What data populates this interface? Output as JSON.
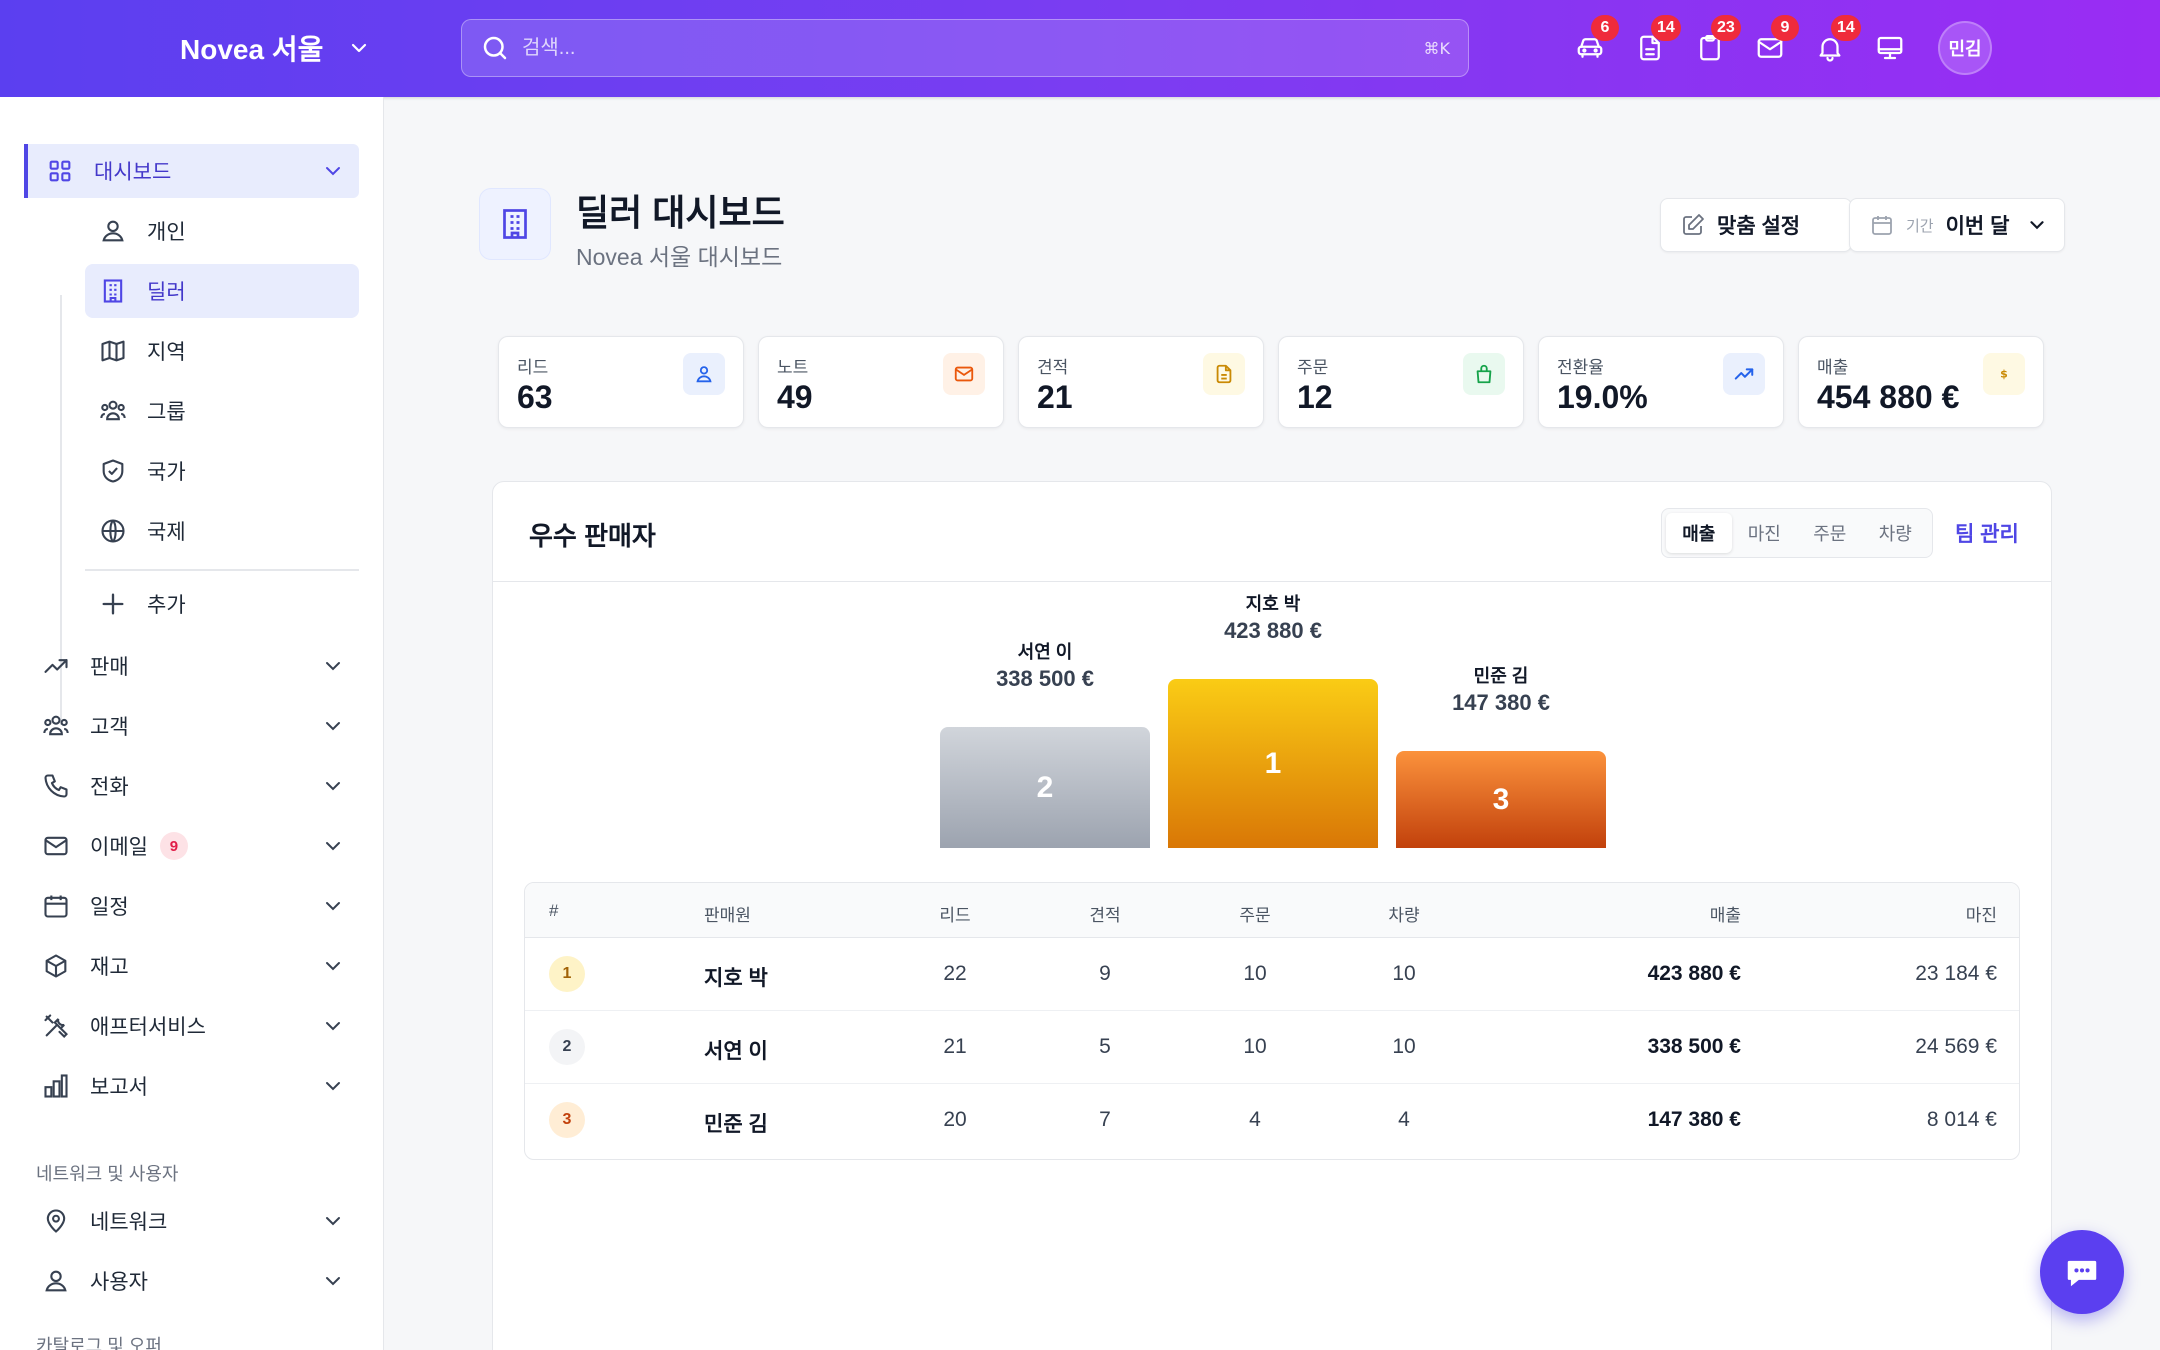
{
  "header": {
    "brand": "Novea 서울",
    "search_placeholder": "검색...",
    "search_shortcut": "⌘K",
    "icons": [
      {
        "name": "car-icon",
        "badge": "6"
      },
      {
        "name": "document-icon",
        "badge": "14"
      },
      {
        "name": "clipboard-icon",
        "badge": "23"
      },
      {
        "name": "mail-icon",
        "badge": "9"
      },
      {
        "name": "bell-icon",
        "badge": "14"
      },
      {
        "name": "monitor-icon",
        "badge": ""
      }
    ],
    "avatar": "민김"
  },
  "sidebar": {
    "dashboard": "대시보드",
    "sub": [
      "개인",
      "딜러",
      "지역",
      "그룹",
      "국가",
      "국제"
    ],
    "add": "추가",
    "items": [
      "판매",
      "고객",
      "전화",
      "이메일",
      "일정",
      "재고",
      "애프터서비스",
      "보고서"
    ],
    "email_badge": "9",
    "section_network": "네트워크 및 사용자",
    "network_items": [
      "네트워크",
      "사용자"
    ],
    "section_catalog": "카탈로그 및 오퍼"
  },
  "page": {
    "title": "딜러 대시보드",
    "subtitle": "Novea 서울 대시보드",
    "customize": "맞춤 설정",
    "period_label": "기간",
    "period_value": "이번 달"
  },
  "kpis": [
    {
      "label": "리드",
      "value": "63",
      "color": "#2563eb",
      "bg": "#eaf0fd",
      "icon": "user-icon"
    },
    {
      "label": "노트",
      "value": "49",
      "color": "#ea580c",
      "bg": "#fff1e6",
      "icon": "mail-icon"
    },
    {
      "label": "견적",
      "value": "21",
      "color": "#ca8a04",
      "bg": "#fef9e3",
      "icon": "document-icon"
    },
    {
      "label": "주문",
      "value": "12",
      "color": "#16a34a",
      "bg": "#e9f9ef",
      "icon": "bag-icon"
    },
    {
      "label": "전환율",
      "value": "19.0%",
      "color": "#2563eb",
      "bg": "#eaf0fd",
      "icon": "trend-icon"
    },
    {
      "label": "매출",
      "value": "454 880 €",
      "color": "#ca8a04",
      "bg": "#fef9e3",
      "icon": "dollar-icon"
    }
  ],
  "top_sellers": {
    "title": "우수 판매자",
    "tabs": [
      "매출",
      "마진",
      "주문",
      "차량"
    ],
    "active_tab": "매출",
    "manage": "팀 관리",
    "podium": [
      {
        "rank": "2",
        "name": "서연 이",
        "amount": "338 500 €"
      },
      {
        "rank": "1",
        "name": "지호 박",
        "amount": "423 880 €"
      },
      {
        "rank": "3",
        "name": "민준 김",
        "amount": "147 380 €"
      }
    ],
    "columns": [
      "#",
      "판매원",
      "리드",
      "견적",
      "주문",
      "차량",
      "매출",
      "마진"
    ],
    "rows": [
      {
        "rank": "1",
        "name": "지호 박",
        "leads": "22",
        "quotes": "9",
        "orders": "10",
        "vehicles": "10",
        "revenue": "423 880 €",
        "margin": "23 184 €"
      },
      {
        "rank": "2",
        "name": "서연 이",
        "leads": "21",
        "quotes": "5",
        "orders": "10",
        "vehicles": "10",
        "revenue": "338 500 €",
        "margin": "24 569 €"
      },
      {
        "rank": "3",
        "name": "민준 김",
        "leads": "20",
        "quotes": "7",
        "orders": "4",
        "vehicles": "4",
        "revenue": "147 380 €",
        "margin": "8 014 €"
      }
    ]
  }
}
